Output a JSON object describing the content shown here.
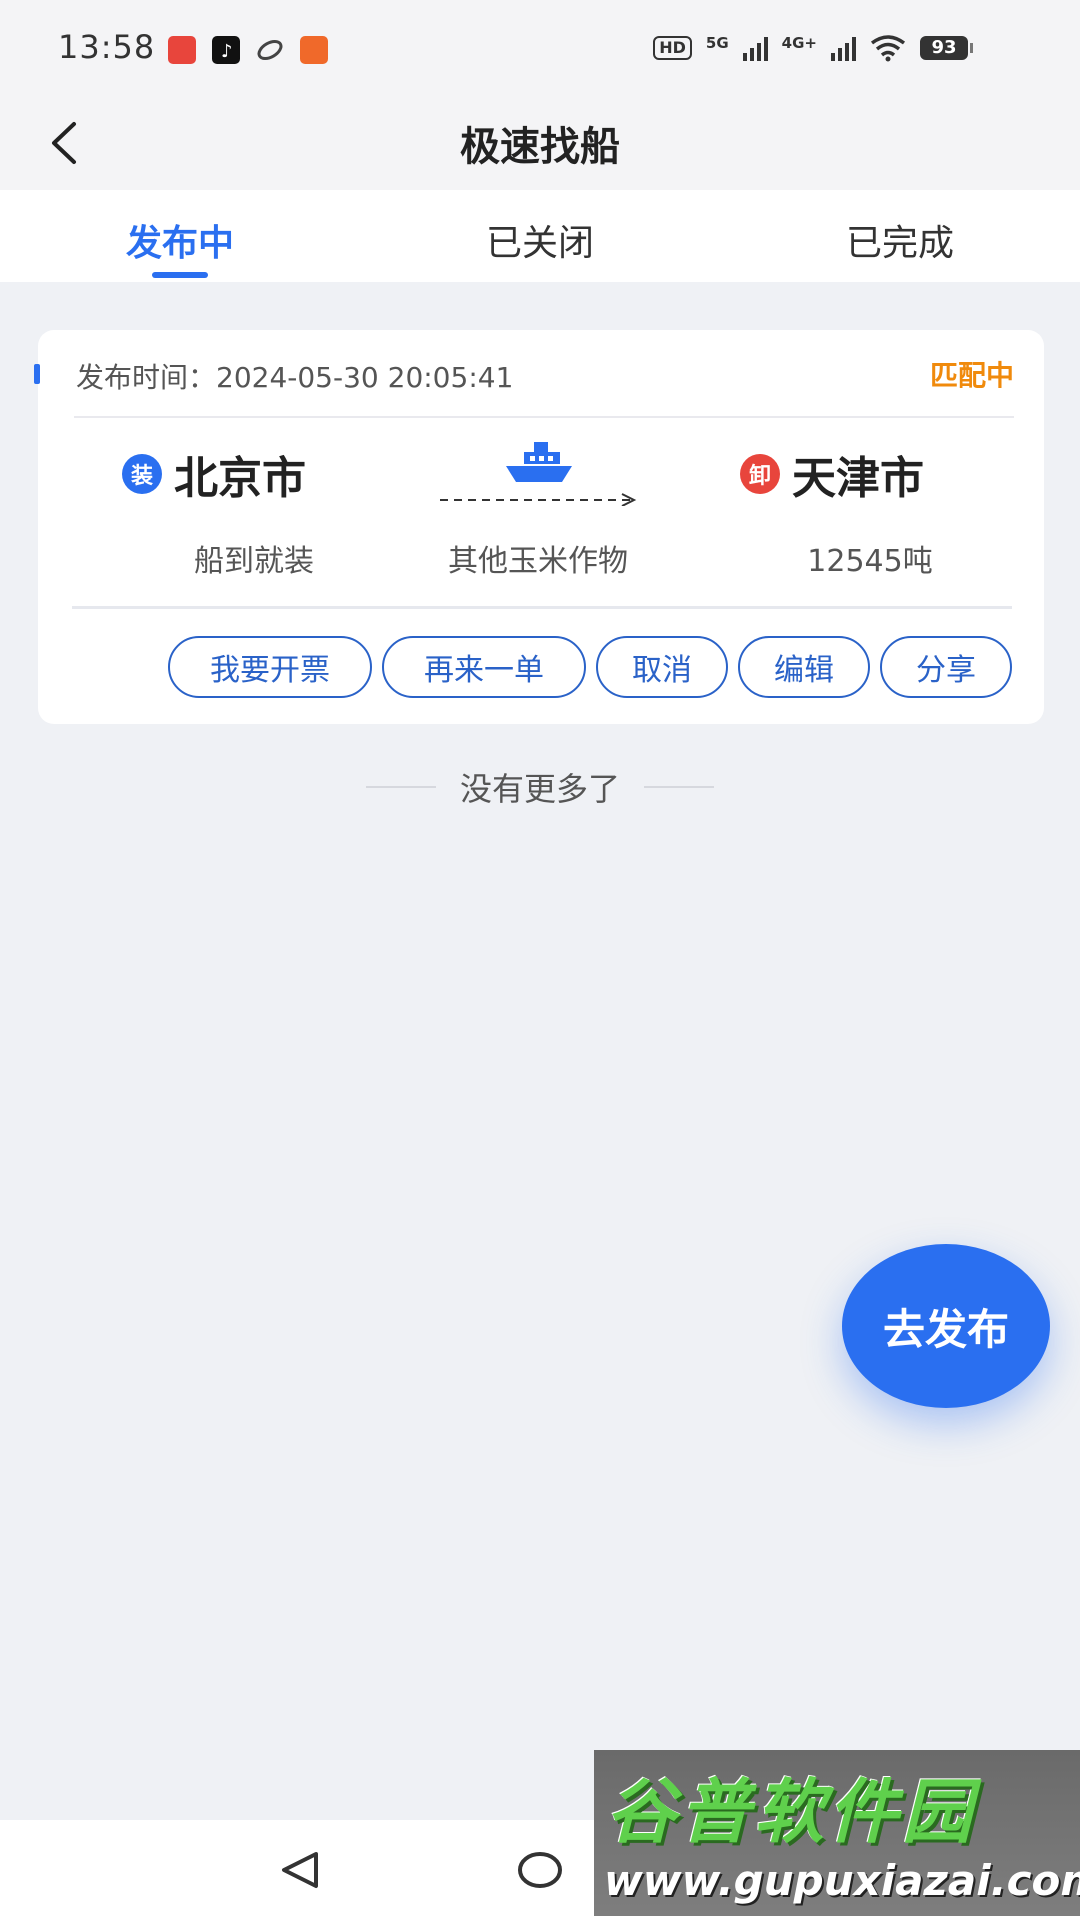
{
  "status_bar": {
    "time": "13:58",
    "hd_badge": "HD",
    "net_5g": "5G",
    "net_4g": "4G+",
    "battery": "93",
    "app_icons": [
      "red-app-icon",
      "tiktok-icon",
      "shoe-brand-icon",
      "orange-app-icon"
    ]
  },
  "header": {
    "title": "极速找船"
  },
  "tabs": [
    {
      "label": "发布中",
      "active": true
    },
    {
      "label": "已关闭",
      "active": false
    },
    {
      "label": "已完成",
      "active": false
    }
  ],
  "order_card": {
    "publish_time": "发布时间：2024-05-30 20:05:41",
    "status": "匹配中",
    "origin": {
      "badge": "装",
      "city": "北京市",
      "note": "船到就装"
    },
    "cargo": "其他玉米作物",
    "destination": {
      "badge": "卸",
      "city": "天津市",
      "note": "12545吨"
    },
    "actions": [
      "我要开票",
      "再来一单",
      "取消",
      "编辑",
      "分享"
    ]
  },
  "list_footer": "没有更多了",
  "fab_label": "去发布",
  "watermark": {
    "title": "谷普软件园",
    "url": "www.gupuxiazai.com"
  },
  "colors": {
    "primary": "#2a6ff0",
    "status_orange": "#f08a0c",
    "origin_badge": "#2a6ff0",
    "destination_badge": "#e8453c"
  }
}
